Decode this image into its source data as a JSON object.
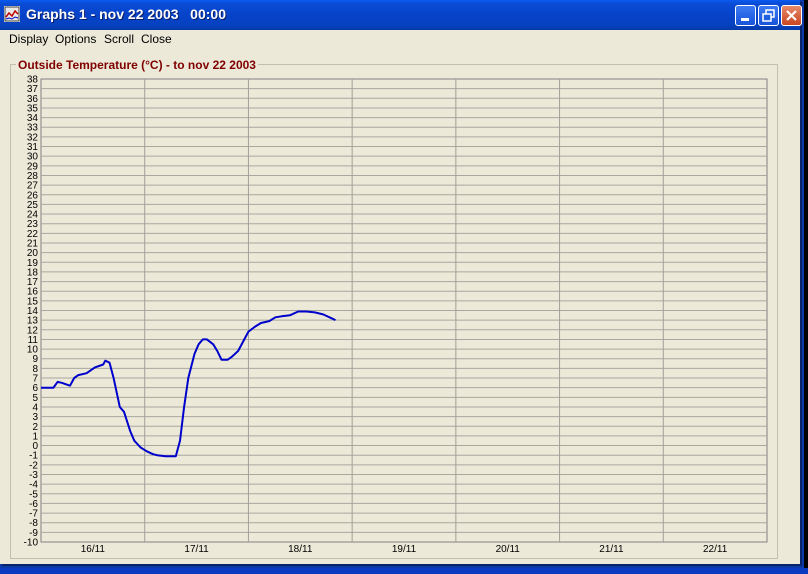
{
  "window": {
    "title": "Graphs 1 - nov 22 2003   00:00"
  },
  "menu": {
    "items": [
      "Display",
      "Options",
      "Scroll",
      "Close"
    ]
  },
  "colors": {
    "title_text": "#800000",
    "series_line": "#0000CC",
    "grid": "#A0A0A0",
    "plot_bg": "#ECE9D8"
  },
  "chart_data": {
    "type": "line",
    "title": "Outside Temperature (°C) - to nov 22 2003",
    "x_tick_labels": [
      "16/11",
      "17/11",
      "18/11",
      "19/11",
      "20/11",
      "21/11",
      "22/11"
    ],
    "xlim": [
      0,
      7
    ],
    "ylim": [
      -10,
      38
    ],
    "y_tick_step": 1,
    "grid": true,
    "series": [
      {
        "x": [
          0.0,
          0.12,
          0.16,
          0.2,
          0.28,
          0.32,
          0.36,
          0.44,
          0.52,
          0.6,
          0.62,
          0.66,
          0.7,
          0.76,
          0.8,
          0.86,
          0.9,
          0.96,
          1.02,
          1.08,
          1.12,
          1.2,
          1.3,
          1.34,
          1.38,
          1.42,
          1.48,
          1.52,
          1.56,
          1.6,
          1.66,
          1.7,
          1.74,
          1.8,
          1.84,
          1.9,
          1.96,
          2.0,
          2.06,
          2.12,
          2.2,
          2.26,
          2.32,
          2.4,
          2.48,
          2.56,
          2.64,
          2.72,
          2.8,
          2.84
        ],
        "y": [
          6.0,
          6.0,
          6.6,
          6.5,
          6.2,
          7.0,
          7.3,
          7.5,
          8.1,
          8.4,
          8.8,
          8.6,
          7.0,
          4.0,
          3.5,
          1.5,
          0.5,
          -0.2,
          -0.6,
          -0.9,
          -1.0,
          -1.1,
          -1.1,
          0.5,
          4.0,
          7.0,
          9.5,
          10.5,
          11.0,
          11.0,
          10.5,
          9.8,
          8.9,
          8.9,
          9.2,
          9.8,
          11.0,
          11.8,
          12.3,
          12.7,
          12.9,
          13.3,
          13.4,
          13.5,
          13.9,
          13.9,
          13.8,
          13.6,
          13.2,
          13.0
        ]
      }
    ]
  }
}
